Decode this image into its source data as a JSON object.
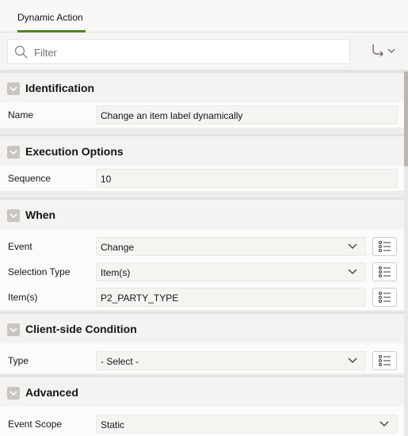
{
  "tabs": [
    {
      "label": "Dynamic Action",
      "active": true
    }
  ],
  "filter": {
    "placeholder": "Filter"
  },
  "groups": [
    {
      "title": "Identification",
      "rows": [
        {
          "label": "Name",
          "value": "Change an item label dynamically"
        }
      ]
    },
    {
      "title": "Execution Options",
      "rows": [
        {
          "label": "Sequence",
          "value": "10"
        }
      ]
    },
    {
      "title": "When",
      "rows": [
        {
          "label": "Event",
          "value": "Change"
        },
        {
          "label": "Selection Type",
          "value": "Item(s)"
        },
        {
          "label": "Item(s)",
          "value": "P2_PARTY_TYPE"
        }
      ]
    },
    {
      "title": "Client-side Condition",
      "rows": [
        {
          "label": "Type",
          "value": "- Select -"
        }
      ]
    },
    {
      "title": "Advanced",
      "rows": [
        {
          "label": "Event Scope",
          "value": "Static"
        }
      ]
    }
  ],
  "colors": {
    "accent": "#508223",
    "background": "#fcfbfa",
    "header": "#f4f3f1"
  },
  "icons": [
    "search-icon",
    "go-to-group-icon",
    "chevron-down-icon",
    "collapse-icon",
    "list-of-values-icon"
  ]
}
